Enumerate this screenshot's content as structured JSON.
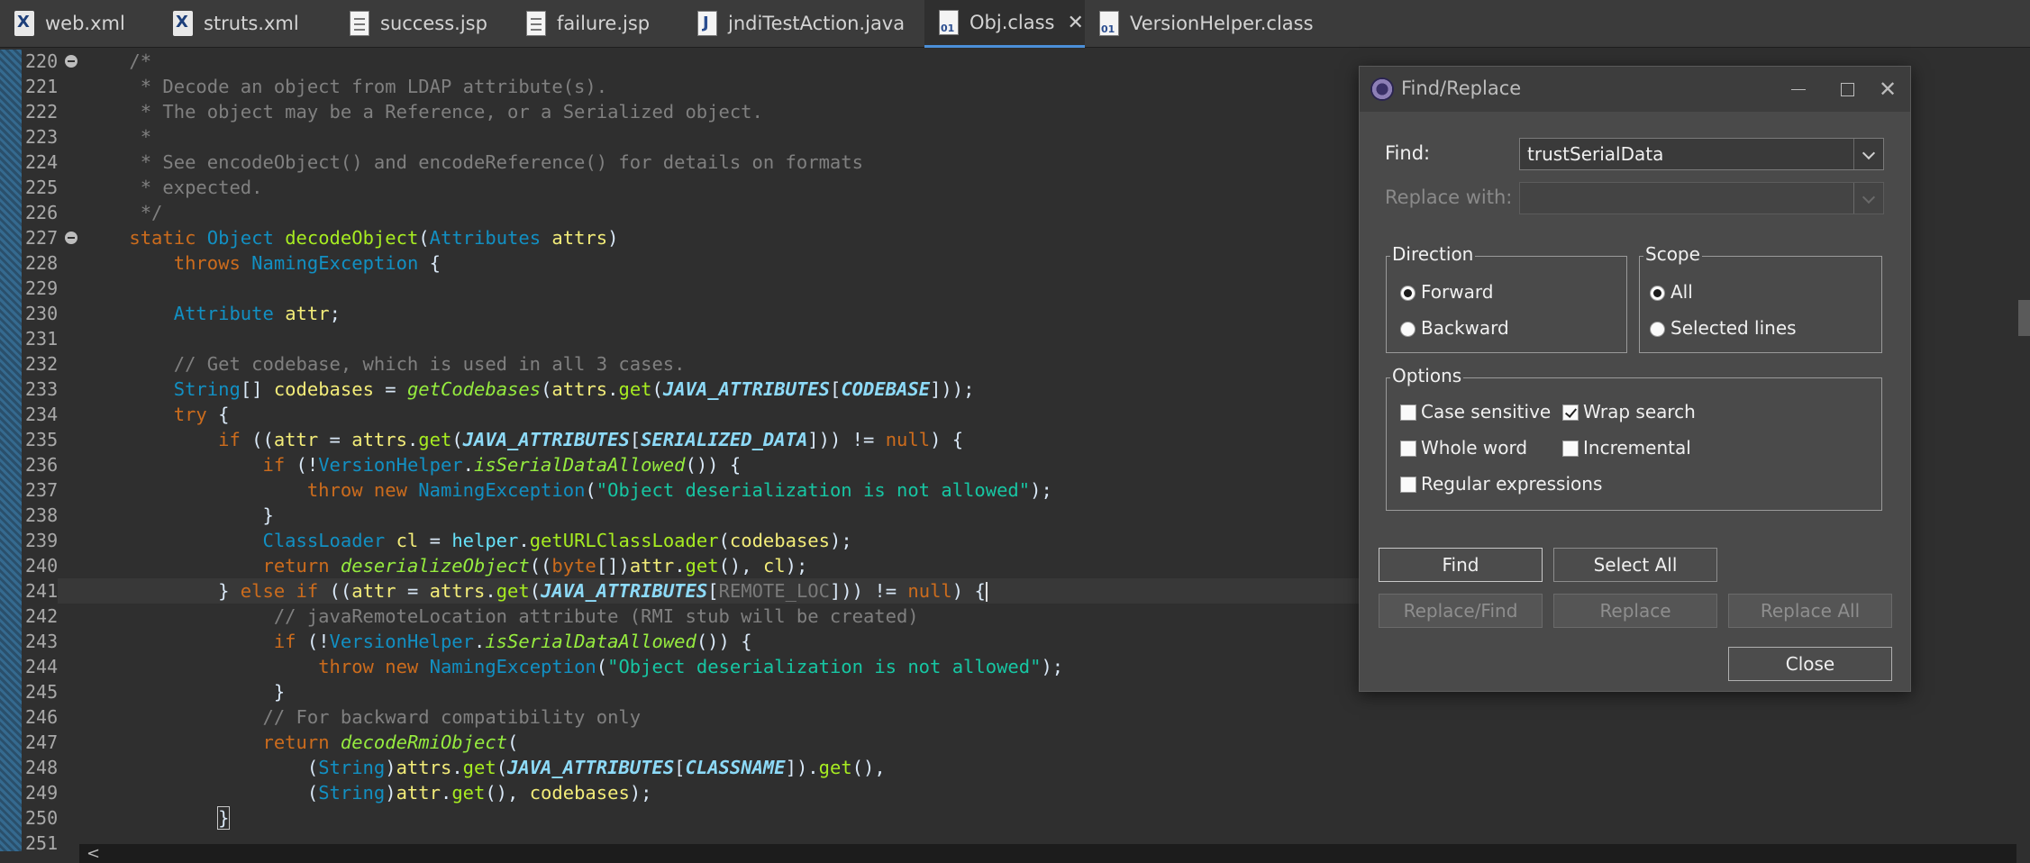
{
  "tabs": [
    {
      "label": "web.xml",
      "icon": "xml-file-icon",
      "active": false
    },
    {
      "label": "struts.xml",
      "icon": "xml-file-icon",
      "active": false
    },
    {
      "label": "success.jsp",
      "icon": "jsp-file-icon",
      "active": false
    },
    {
      "label": "failure.jsp",
      "icon": "jsp-file-icon",
      "active": false
    },
    {
      "label": "jndiTestAction.java",
      "icon": "java-file-icon",
      "active": false
    },
    {
      "label": "Obj.class",
      "icon": "class-file-icon",
      "active": true,
      "close": "✕"
    },
    {
      "label": "VersionHelper.class",
      "icon": "class-file-icon",
      "active": false
    }
  ],
  "editor": {
    "line_numbers": [
      "220",
      "221",
      "222",
      "223",
      "224",
      "225",
      "226",
      "227",
      "228",
      "229",
      "230",
      "231",
      "232",
      "233",
      "234",
      "235",
      "236",
      "237",
      "238",
      "239",
      "240",
      "241",
      "242",
      "243",
      "244",
      "245",
      "246",
      "247",
      "248",
      "249",
      "250",
      "251"
    ],
    "folded_lines": [
      "220",
      "227"
    ],
    "current_line": "241",
    "code_lines": [
      [
        {
          "t": "    /*",
          "c": "cm"
        }
      ],
      [
        {
          "t": "     * Decode an object from LDAP attribute(s).",
          "c": "cm"
        }
      ],
      [
        {
          "t": "     * The object may be a Reference, or a Serialized object.",
          "c": "cm"
        }
      ],
      [
        {
          "t": "     *",
          "c": "cm"
        }
      ],
      [
        {
          "t": "     * See encodeObject() and encodeReference() for details on formats",
          "c": "cm"
        }
      ],
      [
        {
          "t": "     * expected.",
          "c": "cm"
        }
      ],
      [
        {
          "t": "     */",
          "c": "cm"
        }
      ],
      [
        {
          "t": "    ",
          "c": "pl"
        },
        {
          "t": "static",
          "c": "kw"
        },
        {
          "t": " ",
          "c": "pl"
        },
        {
          "t": "Object",
          "c": "ty"
        },
        {
          "t": " ",
          "c": "pl"
        },
        {
          "t": "decodeObject",
          "c": "mt"
        },
        {
          "t": "(",
          "c": "pl"
        },
        {
          "t": "Attributes",
          "c": "ty"
        },
        {
          "t": " ",
          "c": "pl"
        },
        {
          "t": "attrs",
          "c": "hv"
        },
        {
          "t": ")",
          "c": "pl"
        }
      ],
      [
        {
          "t": "        ",
          "c": "pl"
        },
        {
          "t": "throws",
          "c": "kw"
        },
        {
          "t": " ",
          "c": "pl"
        },
        {
          "t": "NamingException",
          "c": "ty"
        },
        {
          "t": " {",
          "c": "pl"
        }
      ],
      [
        {
          "t": "",
          "c": "pl"
        }
      ],
      [
        {
          "t": "        ",
          "c": "pl"
        },
        {
          "t": "Attribute",
          "c": "ty"
        },
        {
          "t": " ",
          "c": "pl"
        },
        {
          "t": "attr",
          "c": "hv"
        },
        {
          "t": ";",
          "c": "pl"
        }
      ],
      [
        {
          "t": "",
          "c": "pl"
        }
      ],
      [
        {
          "t": "        // Get codebase, which is used in all 3 cases.",
          "c": "cm"
        }
      ],
      [
        {
          "t": "        ",
          "c": "pl"
        },
        {
          "t": "String",
          "c": "ty"
        },
        {
          "t": "[] ",
          "c": "pl"
        },
        {
          "t": "codebases",
          "c": "hv"
        },
        {
          "t": " = ",
          "c": "pl"
        },
        {
          "t": "getCodebases",
          "c": "mi"
        },
        {
          "t": "(",
          "c": "pl"
        },
        {
          "t": "attrs",
          "c": "hv"
        },
        {
          "t": ".",
          "c": "pl"
        },
        {
          "t": "get",
          "c": "mt"
        },
        {
          "t": "(",
          "c": "pl"
        },
        {
          "t": "JAVA_ATTRIBUTES",
          "c": "cs"
        },
        {
          "t": "[",
          "c": "pl"
        },
        {
          "t": "CODEBASE",
          "c": "cs"
        },
        {
          "t": "]));",
          "c": "pl"
        }
      ],
      [
        {
          "t": "        ",
          "c": "pl"
        },
        {
          "t": "try",
          "c": "kw"
        },
        {
          "t": " {",
          "c": "pl"
        }
      ],
      [
        {
          "t": "            ",
          "c": "pl"
        },
        {
          "t": "if",
          "c": "kw"
        },
        {
          "t": " ((",
          "c": "pl"
        },
        {
          "t": "attr",
          "c": "hv"
        },
        {
          "t": " = ",
          "c": "pl"
        },
        {
          "t": "attrs",
          "c": "hv"
        },
        {
          "t": ".",
          "c": "pl"
        },
        {
          "t": "get",
          "c": "mt"
        },
        {
          "t": "(",
          "c": "pl"
        },
        {
          "t": "JAVA_ATTRIBUTES",
          "c": "cs"
        },
        {
          "t": "[",
          "c": "pl"
        },
        {
          "t": "SERIALIZED_DATA",
          "c": "cs"
        },
        {
          "t": "])) != ",
          "c": "pl"
        },
        {
          "t": "null",
          "c": "kw"
        },
        {
          "t": ") {",
          "c": "pl"
        }
      ],
      [
        {
          "t": "                ",
          "c": "pl"
        },
        {
          "t": "if",
          "c": "kw"
        },
        {
          "t": " (!",
          "c": "pl"
        },
        {
          "t": "VersionHelper",
          "c": "ty"
        },
        {
          "t": ".",
          "c": "pl"
        },
        {
          "t": "isSerialDataAllowed",
          "c": "mi"
        },
        {
          "t": "()) {",
          "c": "pl"
        }
      ],
      [
        {
          "t": "                    ",
          "c": "pl"
        },
        {
          "t": "throw",
          "c": "kw"
        },
        {
          "t": " ",
          "c": "pl"
        },
        {
          "t": "new",
          "c": "kw"
        },
        {
          "t": " ",
          "c": "pl"
        },
        {
          "t": "NamingException",
          "c": "ty"
        },
        {
          "t": "(",
          "c": "pl"
        },
        {
          "t": "\"Object deserialization is not allowed\"",
          "c": "st"
        },
        {
          "t": ");",
          "c": "pl"
        }
      ],
      [
        {
          "t": "                }",
          "c": "pl"
        }
      ],
      [
        {
          "t": "                ",
          "c": "pl"
        },
        {
          "t": "ClassLoader",
          "c": "ty"
        },
        {
          "t": " ",
          "c": "pl"
        },
        {
          "t": "cl",
          "c": "hv"
        },
        {
          "t": " = ",
          "c": "pl"
        },
        {
          "t": "helper",
          "c": "fd"
        },
        {
          "t": ".",
          "c": "pl"
        },
        {
          "t": "getURLClassLoader",
          "c": "mt"
        },
        {
          "t": "(",
          "c": "pl"
        },
        {
          "t": "codebases",
          "c": "hv"
        },
        {
          "t": ");",
          "c": "pl"
        }
      ],
      [
        {
          "t": "                ",
          "c": "pl"
        },
        {
          "t": "return",
          "c": "kw"
        },
        {
          "t": " ",
          "c": "pl"
        },
        {
          "t": "deserializeObject",
          "c": "mi"
        },
        {
          "t": "((",
          "c": "pl"
        },
        {
          "t": "byte",
          "c": "kw"
        },
        {
          "t": "[])",
          "c": "pl"
        },
        {
          "t": "attr",
          "c": "hv"
        },
        {
          "t": ".",
          "c": "pl"
        },
        {
          "t": "get",
          "c": "mt"
        },
        {
          "t": "(), ",
          "c": "pl"
        },
        {
          "t": "cl",
          "c": "hv"
        },
        {
          "t": ");",
          "c": "pl"
        }
      ],
      [
        {
          "t": "            } ",
          "c": "pl"
        },
        {
          "t": "else",
          "c": "kw"
        },
        {
          "t": " ",
          "c": "pl"
        },
        {
          "t": "if",
          "c": "kw"
        },
        {
          "t": " ((",
          "c": "pl"
        },
        {
          "t": "attr",
          "c": "hv"
        },
        {
          "t": " = ",
          "c": "pl"
        },
        {
          "t": "attrs",
          "c": "hv"
        },
        {
          "t": ".",
          "c": "pl"
        },
        {
          "t": "get",
          "c": "mt"
        },
        {
          "t": "(",
          "c": "pl"
        },
        {
          "t": "JAVA_ATTRIBUTES",
          "c": "cs"
        },
        {
          "t": "[",
          "c": "pl"
        },
        {
          "t": "REMOTE_LOC",
          "c": "gh"
        },
        {
          "t": "])) != ",
          "c": "pl"
        },
        {
          "t": "null",
          "c": "kw"
        },
        {
          "t": ") {",
          "c": "pl"
        },
        {
          "t": "",
          "c": "cursor"
        }
      ],
      [
        {
          "t": "                 // javaRemoteLocation attribute (RMI stub will be created)",
          "c": "cm"
        }
      ],
      [
        {
          "t": "                 ",
          "c": "pl"
        },
        {
          "t": "if",
          "c": "kw"
        },
        {
          "t": " (!",
          "c": "pl"
        },
        {
          "t": "VersionHelper",
          "c": "ty"
        },
        {
          "t": ".",
          "c": "pl"
        },
        {
          "t": "isSerialDataAllowed",
          "c": "mi"
        },
        {
          "t": "()) {",
          "c": "pl"
        }
      ],
      [
        {
          "t": "                     ",
          "c": "pl"
        },
        {
          "t": "throw",
          "c": "kw"
        },
        {
          "t": " ",
          "c": "pl"
        },
        {
          "t": "new",
          "c": "kw"
        },
        {
          "t": " ",
          "c": "pl"
        },
        {
          "t": "NamingException",
          "c": "ty"
        },
        {
          "t": "(",
          "c": "pl"
        },
        {
          "t": "\"Object deserialization is not allowed\"",
          "c": "st"
        },
        {
          "t": ");",
          "c": "pl"
        }
      ],
      [
        {
          "t": "                 }",
          "c": "pl"
        }
      ],
      [
        {
          "t": "                // For backward compatibility only",
          "c": "cm"
        }
      ],
      [
        {
          "t": "                ",
          "c": "pl"
        },
        {
          "t": "return",
          "c": "kw"
        },
        {
          "t": " ",
          "c": "pl"
        },
        {
          "t": "decodeRmiObject",
          "c": "mi"
        },
        {
          "t": "(",
          "c": "pl"
        }
      ],
      [
        {
          "t": "                    (",
          "c": "pl"
        },
        {
          "t": "String",
          "c": "ty"
        },
        {
          "t": ")",
          "c": "pl"
        },
        {
          "t": "attrs",
          "c": "hv"
        },
        {
          "t": ".",
          "c": "pl"
        },
        {
          "t": "get",
          "c": "mt"
        },
        {
          "t": "(",
          "c": "pl"
        },
        {
          "t": "JAVA_ATTRIBUTES",
          "c": "cs"
        },
        {
          "t": "[",
          "c": "pl"
        },
        {
          "t": "CLASSNAME",
          "c": "cs"
        },
        {
          "t": "]).",
          "c": "pl"
        },
        {
          "t": "get",
          "c": "mt"
        },
        {
          "t": "(),",
          "c": "pl"
        }
      ],
      [
        {
          "t": "                    (",
          "c": "pl"
        },
        {
          "t": "String",
          "c": "ty"
        },
        {
          "t": ")",
          "c": "pl"
        },
        {
          "t": "attr",
          "c": "hv"
        },
        {
          "t": ".",
          "c": "pl"
        },
        {
          "t": "get",
          "c": "mt"
        },
        {
          "t": "(), ",
          "c": "pl"
        },
        {
          "t": "codebases",
          "c": "hv"
        },
        {
          "t": ");",
          "c": "pl"
        }
      ],
      [
        {
          "t": "            ",
          "c": "pl"
        },
        {
          "t": "}",
          "c": "boxbr"
        }
      ],
      [
        {
          "t": "",
          "c": "pl"
        }
      ]
    ]
  },
  "dialog": {
    "title": "Find/Replace",
    "find_label": "Find:",
    "find_value": "trustSerialData",
    "replace_label": "Replace with:",
    "replace_value": "",
    "direction": {
      "title": "Direction",
      "options": [
        {
          "label": "Forward",
          "selected": true
        },
        {
          "label": "Backward",
          "selected": false
        }
      ]
    },
    "scope": {
      "title": "Scope",
      "options": [
        {
          "label": "All",
          "selected": true
        },
        {
          "label": "Selected lines",
          "selected": false
        }
      ]
    },
    "options": {
      "title": "Options",
      "case_sensitive": {
        "label": "Case sensitive",
        "checked": false
      },
      "wrap_search": {
        "label": "Wrap search",
        "checked": true
      },
      "whole_word": {
        "label": "Whole word",
        "checked": false
      },
      "incremental": {
        "label": "Incremental",
        "checked": false
      },
      "regex": {
        "label": "Regular expressions",
        "checked": false
      }
    },
    "buttons": {
      "find": "Find",
      "select_all": "Select All",
      "replace_find": "Replace/Find",
      "replace": "Replace",
      "replace_all": "Replace All",
      "close": "Close"
    }
  }
}
